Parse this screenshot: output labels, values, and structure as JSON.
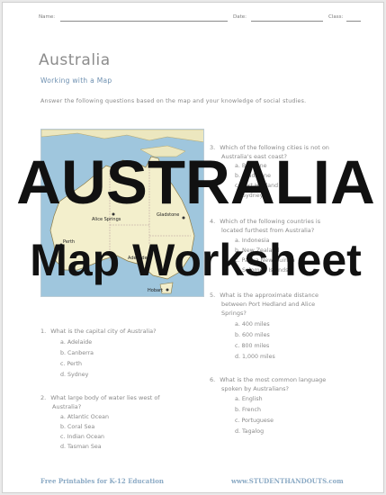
{
  "header": {
    "name_label": "Name:",
    "date_label": "Date:",
    "class_label": "Class:"
  },
  "title": "Australia",
  "subtitle": "Working with a Map",
  "instructions": "Answer the following questions based on the map and your knowledge of social studies.",
  "map": {
    "cities": [
      "Alice Springs",
      "Gladstone",
      "Perth",
      "Adelaide",
      "Hobart"
    ],
    "colors": {
      "sea": "#9fc6dd",
      "land": "#f3efcc",
      "neighbor_land": "#ece7bf"
    }
  },
  "overlay": {
    "line1": "AUSTRALIA",
    "line2": "Map Worksheet"
  },
  "questions": {
    "q1": {
      "num": "1.",
      "text": "What is the capital city of Australia?",
      "options": [
        "a.  Adelaide",
        "b.  Canberra",
        "c.  Perth",
        "d.  Sydney"
      ]
    },
    "q2": {
      "num": "2.",
      "text_1": "What large body of water lies west of",
      "text_2": "Australia?",
      "options": [
        "a.  Atlantic Ocean",
        "b.  Coral Sea",
        "c.  Indian Ocean",
        "d.  Tasman Sea"
      ]
    },
    "q3": {
      "num": "3.",
      "text_1": "Which of the following cities is not on",
      "text_2": "Australia's east coast?",
      "options": [
        "a.  Brisbane",
        "b.  Gladstone",
        "c.  Port Hedland",
        "d.  Sydney"
      ]
    },
    "q4": {
      "num": "4.",
      "text_1": "Which of the following countries is",
      "text_2": "located furthest from Australia?",
      "options": [
        "a.  Indonesia",
        "b.  New Zealand",
        "c.  Papua New Guinea",
        "d.  Solomon Islands"
      ]
    },
    "q5": {
      "num": "5.",
      "text_1": "What is the approximate distance",
      "text_2": "between Port Hedland and Alice",
      "text_3": "Springs?",
      "options": [
        "a.  400 miles",
        "b.  600 miles",
        "c.  800 miles",
        "d.  1,000 miles"
      ]
    },
    "q6": {
      "num": "6.",
      "text_1": "What is the most common language",
      "text_2": "spoken by Australians?",
      "options": [
        "a.  English",
        "b.  French",
        "c.  Portuguese",
        "d.  Tagalog"
      ]
    }
  },
  "footer": {
    "left": "Free Printables for K-12 Education",
    "right": "www.STUDENTHANDOUTS.com"
  }
}
